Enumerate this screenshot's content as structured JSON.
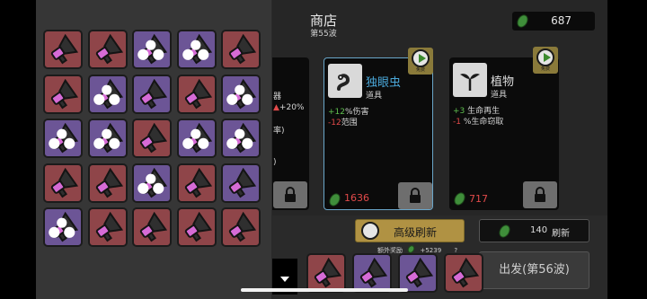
{
  "shop": {
    "title": "商店",
    "wave": "第55波"
  },
  "currency": {
    "amount": "687",
    "icon": "green-seed-icon"
  },
  "inventory": {
    "icon": "megaphone-weapon-icon",
    "slots": [
      {
        "tier": "red",
        "stars": false
      },
      {
        "tier": "red",
        "stars": false
      },
      {
        "tier": "purple",
        "stars": true
      },
      {
        "tier": "purple",
        "stars": true
      },
      {
        "tier": "red",
        "stars": false
      },
      {
        "tier": "red",
        "stars": false
      },
      {
        "tier": "purple",
        "stars": true
      },
      {
        "tier": "purple",
        "stars": false
      },
      {
        "tier": "red",
        "stars": false
      },
      {
        "tier": "purple",
        "stars": true
      },
      {
        "tier": "purple",
        "stars": true
      },
      {
        "tier": "purple",
        "stars": true
      },
      {
        "tier": "red",
        "stars": false
      },
      {
        "tier": "purple",
        "stars": true
      },
      {
        "tier": "purple",
        "stars": true
      },
      {
        "tier": "red",
        "stars": false
      },
      {
        "tier": "red",
        "stars": false
      },
      {
        "tier": "purple",
        "stars": true
      },
      {
        "tier": "red",
        "stars": false
      },
      {
        "tier": "purple",
        "stars": false
      },
      {
        "tier": "purple",
        "stars": true
      },
      {
        "tier": "red",
        "stars": false
      },
      {
        "tier": "red",
        "stars": false
      },
      {
        "tier": "red",
        "stars": false
      },
      {
        "tier": "red",
        "stars": false
      }
    ]
  },
  "cards": {
    "left_partial": {
      "line1": "器",
      "line2": "+20%",
      "line3": "率)",
      "line4": ")"
    },
    "card1": {
      "name": "独眼虫",
      "type": "道具",
      "stat1_val": "+12",
      "stat1_label": "%伤害",
      "stat2_val": "-12",
      "stat2_label": "范围",
      "price": "1636",
      "free_label": "免费"
    },
    "card2": {
      "name": "植物",
      "type": "道具",
      "stat1_val": "+3",
      "stat1_label": "生命再生",
      "stat2_val": "-1",
      "stat2_label": "%生命窃取",
      "price": "717",
      "free_label": "免费"
    }
  },
  "buttons": {
    "advanced_refresh": "高级刷新",
    "refresh_cost": "140",
    "refresh": "刷新",
    "depart": "出发(第56波)"
  },
  "bonus": {
    "label": "额外奖励",
    "value": "+5239",
    "help": "?"
  },
  "colors": {
    "red_tier": "#8f4549",
    "purple_tier": "#6c5596",
    "positive": "#5fbf4f",
    "negative": "#e24a4a",
    "gold": "#b09243"
  }
}
